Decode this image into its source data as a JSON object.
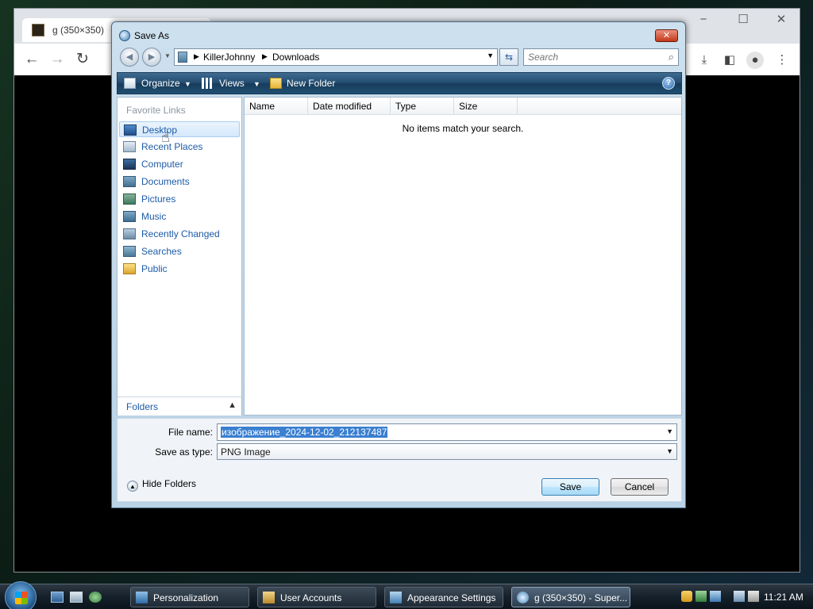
{
  "browser": {
    "tab_title": "g (350×350)",
    "window_controls": [
      "−",
      "☐",
      "✕"
    ]
  },
  "dialog": {
    "title": "Save As",
    "close_label": "✕",
    "address": {
      "crumbs": [
        "KillerJohnny",
        "Downloads"
      ],
      "search_placeholder": "Search"
    },
    "command_bar": {
      "organize": "Organize",
      "views": "Views",
      "new_folder": "New Folder",
      "help": "?"
    },
    "favorite_links_heading": "Favorite Links",
    "favorite_links": [
      {
        "label": "Desktop",
        "icon": "desktop-icon"
      },
      {
        "label": "Recent Places",
        "icon": "recent-places-icon"
      },
      {
        "label": "Computer",
        "icon": "computer-icon"
      },
      {
        "label": "Documents",
        "icon": "documents-icon"
      },
      {
        "label": "Pictures",
        "icon": "pictures-icon"
      },
      {
        "label": "Music",
        "icon": "music-icon"
      },
      {
        "label": "Recently Changed",
        "icon": "recently-changed-icon"
      },
      {
        "label": "Searches",
        "icon": "searches-icon"
      },
      {
        "label": "Public",
        "icon": "public-icon"
      }
    ],
    "folders_label": "Folders",
    "columns": [
      "Name",
      "Date modified",
      "Type",
      "Size"
    ],
    "empty_message": "No items match your search.",
    "file_name_label": "File name:",
    "file_name_value": "изображение_2024-12-02_212137487",
    "save_type_label": "Save as type:",
    "save_type_value": "PNG Image",
    "hide_folders": "Hide Folders",
    "save_button": "Save",
    "cancel_button": "Cancel"
  },
  "taskbar": {
    "tasks": [
      {
        "label": "Personalization"
      },
      {
        "label": "User Accounts"
      },
      {
        "label": "Appearance Settings"
      },
      {
        "label": "g (350×350) - Super..."
      }
    ],
    "clock": "11:21 AM"
  },
  "colors": {
    "accent": "#1d5ba8",
    "selection": "#3a7fd1",
    "command_bar": "#234c70"
  }
}
